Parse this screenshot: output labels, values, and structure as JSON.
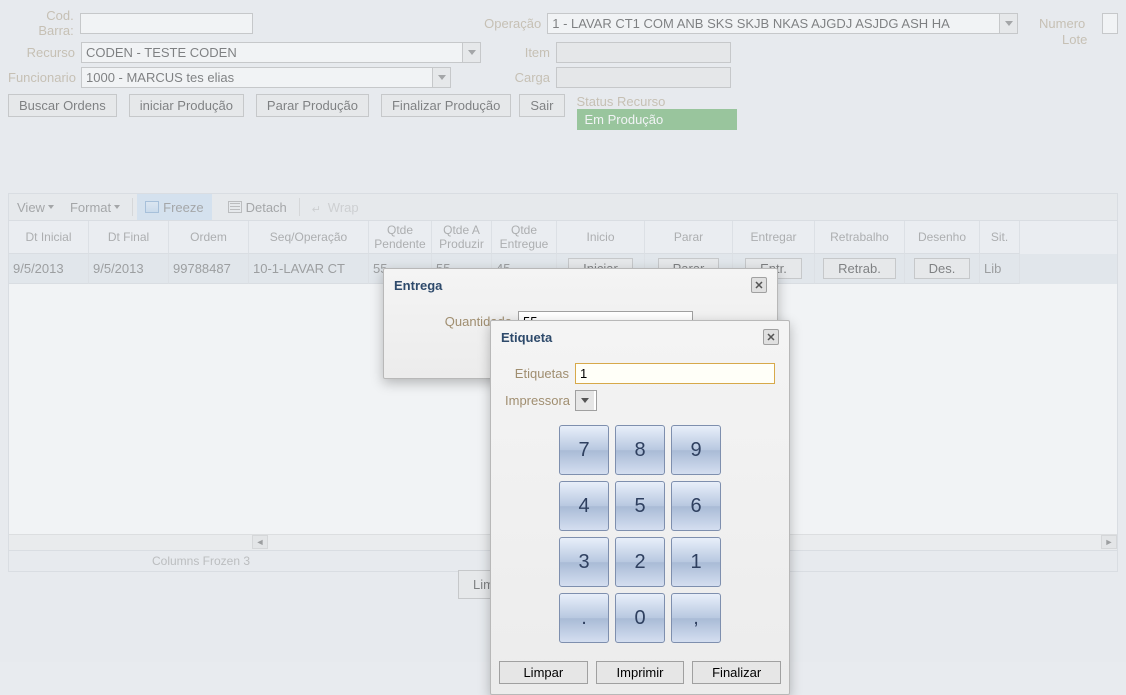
{
  "form": {
    "cod_barra_label": "Cod. Barra:",
    "cod_barra_val": "",
    "operacao_label": "Operação",
    "operacao_val": "1 - LAVAR CT1 COM ANB SKS SKJB NKAS AJGDJ ASJDG ASH HA",
    "recurso_label": "Recurso",
    "recurso_val": "CODEN - TESTE CODEN",
    "item_label": "Item",
    "item_val": "",
    "funcionario_label": "Funcionario",
    "funcionario_val": "1000 - MARCUS tes elias",
    "carga_label": "Carga",
    "carga_val": "",
    "numero_lote_label_l1": "Numero",
    "numero_lote_label_l2": "Lote",
    "status_label": "Status Recurso",
    "status_val": "Em Produção"
  },
  "buttons": {
    "buscar": "Buscar Ordens",
    "iniciar_prod": "iniciar Produção",
    "parar_prod": "Parar Produção",
    "finalizar_prod": "Finalizar Produção",
    "sair": "Sair",
    "limpar_small": "Limpar"
  },
  "toolbar": {
    "view": "View",
    "format": "Format",
    "freeze": "Freeze",
    "detach": "Detach",
    "wrap": "Wrap"
  },
  "grid": {
    "headers": [
      "Dt Inicial",
      "Dt Final",
      "Ordem",
      "Seq/Operação",
      "Qtde Pendente",
      "Qtde A Produzir",
      "Qtde Entregue",
      "Inicio",
      "Parar",
      "Entregar",
      "Retrabalho",
      "Desenho",
      "Sit."
    ],
    "row": {
      "dt_inicial": "9/5/2013",
      "dt_final": "9/5/2013",
      "ordem": "99788487",
      "seq_op": "10-1-LAVAR CT",
      "pend": "55",
      "prod": "55",
      "entr": "45",
      "b_iniciar": "Iniciar",
      "b_parar": "Parar",
      "b_entr": "Entr.",
      "b_retrab": "Retrab.",
      "b_des": "Des.",
      "sit": "Lib"
    },
    "status": "Columns Frozen 3"
  },
  "entrega": {
    "title": "Entrega",
    "quantidade_lbl": "Quantidade",
    "quantidade_val": "55"
  },
  "etiqueta": {
    "title": "Etiqueta",
    "etq_lbl": "Etiquetas",
    "etq_val": "1",
    "imp_lbl": "Impressora",
    "keys": [
      "7",
      "8",
      "9",
      "4",
      "5",
      "6",
      "3",
      "2",
      "1",
      ".",
      "0",
      ","
    ],
    "limpar": "Limpar",
    "imprimir": "Imprimir",
    "finalizar": "Finalizar"
  }
}
